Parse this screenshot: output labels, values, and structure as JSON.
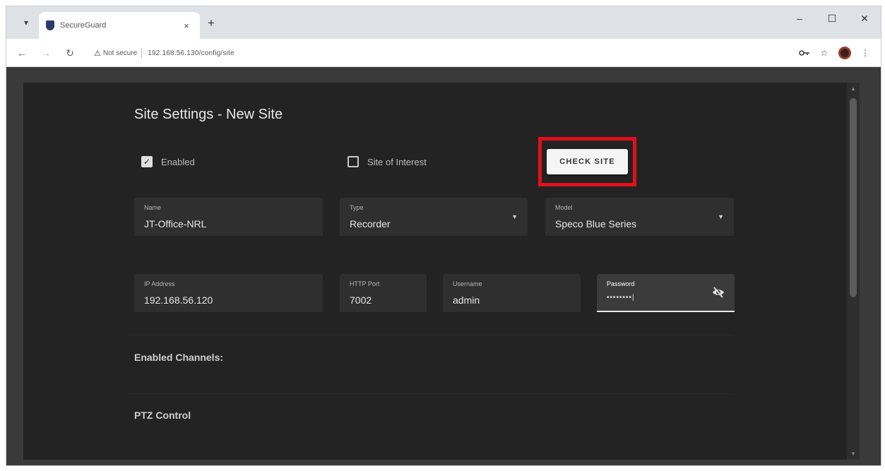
{
  "browser": {
    "tab_title": "SecureGuard",
    "tab_close": "×",
    "new_tab": "+",
    "minimize": "–",
    "maximize": "☐",
    "close": "✕",
    "security_label": "Not secure",
    "url": "192.168.56.130/config/site"
  },
  "page": {
    "title": "Site Settings - New Site",
    "enabled_label": "Enabled",
    "enabled_checked": true,
    "site_of_interest_label": "Site of Interest",
    "site_of_interest_checked": false,
    "check_site_label": "CHECK SITE",
    "fields": {
      "name": {
        "label": "Name",
        "value": "JT-Office-NRL"
      },
      "type": {
        "label": "Type",
        "value": "Recorder"
      },
      "model": {
        "label": "Model",
        "value": "Speco Blue Series"
      },
      "ip": {
        "label": "IP Address",
        "value": "192.168.56.120"
      },
      "port": {
        "label": "HTTP Port",
        "value": "7002"
      },
      "username": {
        "label": "Username",
        "value": "admin"
      },
      "password": {
        "label": "Password",
        "value": "••••••••|"
      }
    },
    "enabled_channels": "Enabled Channels:",
    "ptz_control": "PTZ Control"
  },
  "colors": {
    "highlight": "#e0101a",
    "panel_bg": "#232323",
    "field_bg": "#2f2f2f"
  }
}
